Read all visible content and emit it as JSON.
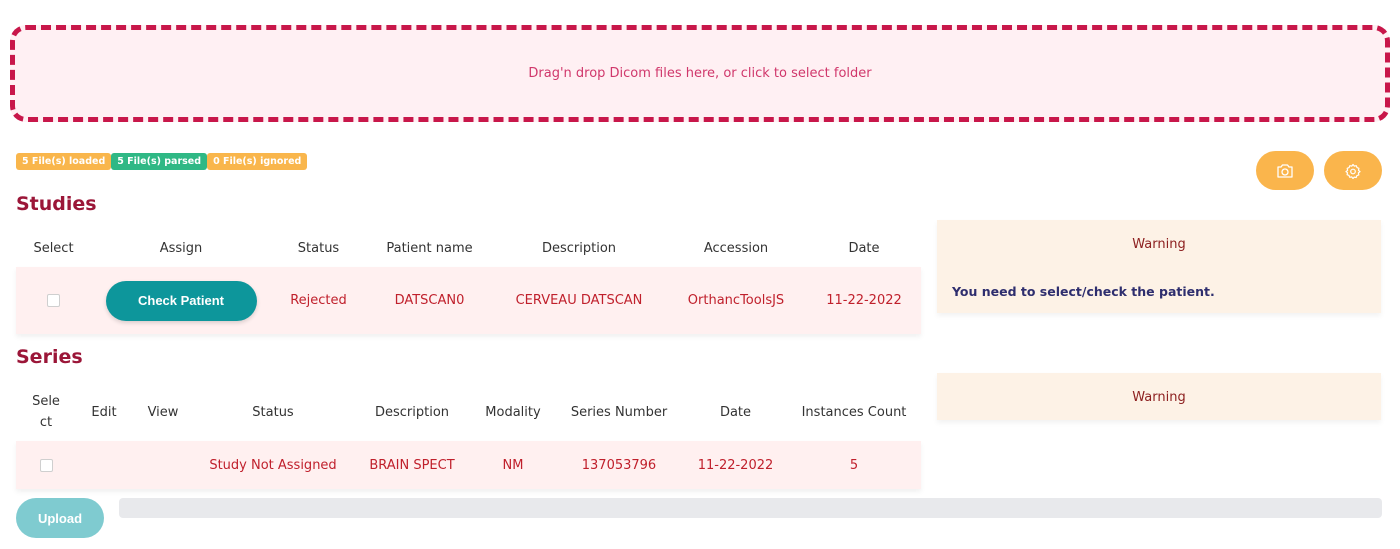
{
  "dropzone": {
    "text": "Drag'n drop Dicom files here, or click to select folder"
  },
  "badges": [
    {
      "label": "5 File(s) loaded",
      "color": "#f9b64c"
    },
    {
      "label": "5 File(s) parsed",
      "color": "#2fb885"
    },
    {
      "label": "0 File(s) ignored",
      "color": "#f9b64c"
    }
  ],
  "toolbar": {
    "camera_icon": "camera-icon",
    "settings_icon": "gear-icon"
  },
  "studies": {
    "title": "Studies",
    "headers": [
      "Select",
      "Assign",
      "Status",
      "Patient name",
      "Description",
      "Accession",
      "Date"
    ],
    "rows": [
      {
        "selected": false,
        "assign_label": "Check Patient",
        "status": "Rejected",
        "patient_name": "DATSCAN0",
        "description": "CERVEAU DATSCAN",
        "accession": "OrthancToolsJS",
        "date": "11-22-2022"
      }
    ],
    "warning": {
      "title": "Warning",
      "message": "You need to select/check the patient."
    }
  },
  "series": {
    "title": "Series",
    "headers": [
      "Sele ct",
      "Edit",
      "View",
      "Status",
      "Description",
      "Modality",
      "Series Number",
      "Date",
      "Instances Count"
    ],
    "rows": [
      {
        "selected": false,
        "edit": "",
        "view": "",
        "status": "Study Not Assigned",
        "description": "BRAIN SPECT",
        "modality": "NM",
        "series_number": "137053796",
        "date": "11-22-2022",
        "instances_count": "5"
      }
    ],
    "warning": {
      "title": "Warning"
    }
  },
  "upload": {
    "label": "Upload",
    "progress_percent": 0
  },
  "colors": {
    "accent": "#c8174a",
    "teal": "#0d969b",
    "orange": "#fab54c",
    "title": "#9b1638"
  }
}
